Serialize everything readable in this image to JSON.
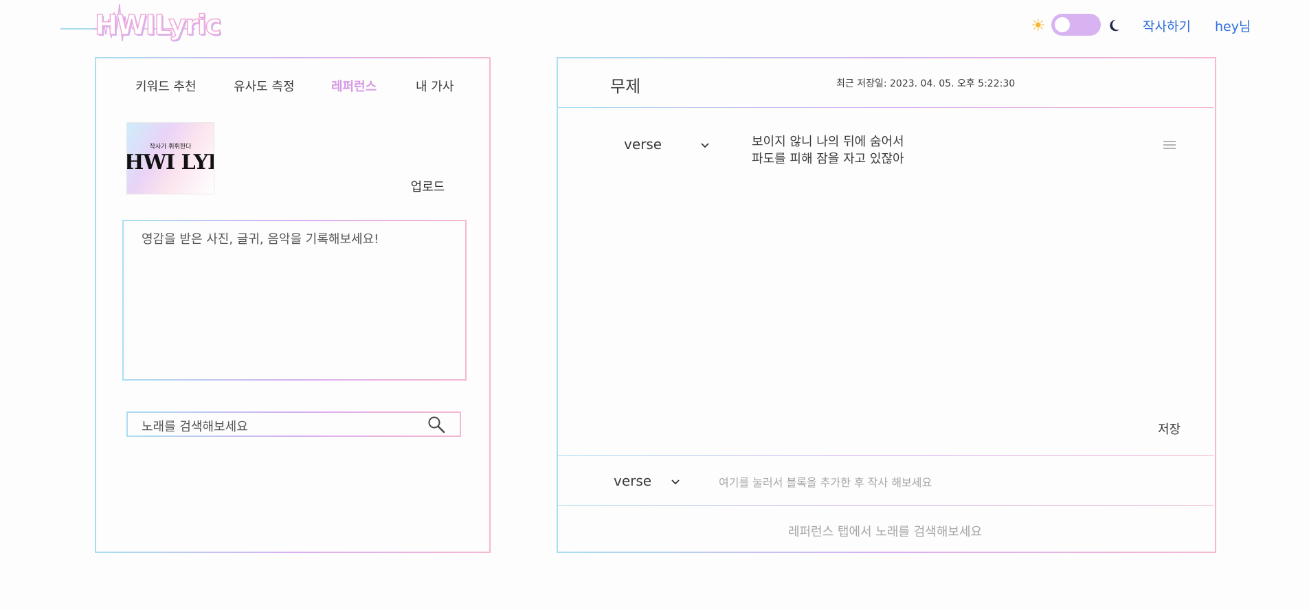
{
  "header": {
    "logo_text": "HWILyric",
    "theme_toggle": {
      "light_icon": "sun-icon",
      "dark_icon": "moon-icon",
      "state": "light"
    },
    "nav": {
      "write": "작사하기",
      "user": "hey님"
    }
  },
  "left_panel": {
    "tabs": [
      {
        "label": "키워드 추천",
        "active": false
      },
      {
        "label": "유사도 측정",
        "active": false
      },
      {
        "label": "레퍼런스",
        "active": true
      },
      {
        "label": "내 가사",
        "active": false
      }
    ],
    "reference_image": {
      "small_text": "작사가 휘휘한다",
      "big_text": "HWI LYRI"
    },
    "upload_label": "업로드",
    "memo_placeholder": "영감을 받은 사진, 글귀, 음악을 기록해보세요!",
    "search_placeholder": "노래를 검색해보세요"
  },
  "right_panel": {
    "title": "무제",
    "last_saved": "최근 저장일: 2023. 04. 05. 오후 5:22:30",
    "blocks": [
      {
        "section": "verse",
        "lines": [
          "보이지 않니 나의 뒤에 숨어서",
          "파도를 피해 잠을 자고 있잖아"
        ]
      }
    ],
    "save_label": "저장",
    "new_block": {
      "section": "verse",
      "placeholder": "여기를 눌러서 블록을 추가한 후 작사 해보세요"
    },
    "bottom_note": "레퍼런스 탭에서 노래를 검색해보세요"
  },
  "colors": {
    "accent_pink": "#f6b7d1",
    "accent_purple": "#d7b0f2",
    "accent_blue": "#a8dff0",
    "link": "#2d6fd9"
  }
}
